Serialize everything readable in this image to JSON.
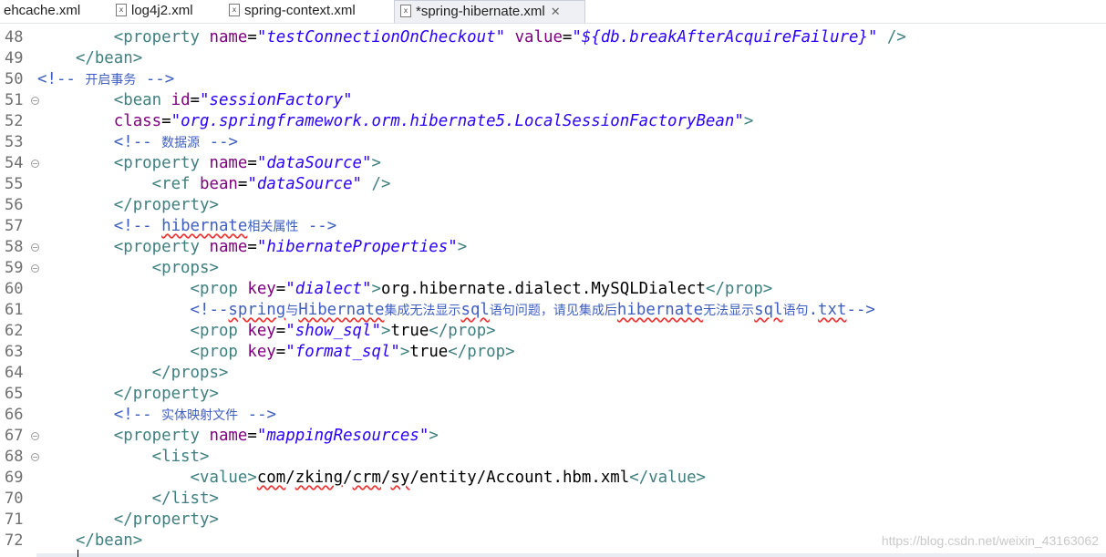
{
  "tabs": [
    {
      "label": "ehcache.xml",
      "active": false
    },
    {
      "label": "log4j2.xml",
      "active": false
    },
    {
      "label": "spring-context.xml",
      "active": false
    },
    {
      "label": "*spring-hibernate.xml",
      "active": true
    }
  ],
  "tab_close_glyph": "✕",
  "tab_icon_glyph": "x",
  "colors": {
    "tag": "#3f7f7f",
    "attribute": "#7f007f",
    "attribute_value": "#2a00ff",
    "comment": "#3f5fbf",
    "text": "#000000",
    "line_number": "#6f6f6f"
  },
  "editor": {
    "lines": [
      {
        "num": "48",
        "fold": false,
        "indent": "        ",
        "segments": [
          {
            "t": "<property ",
            "c": "tg"
          },
          {
            "t": "name",
            "c": "at"
          },
          {
            "t": "=",
            "c": "tx"
          },
          {
            "t": "\"testConnectionOnCheckout\"",
            "c": "av"
          },
          {
            "t": " ",
            "c": "tx"
          },
          {
            "t": "value",
            "c": "at"
          },
          {
            "t": "=",
            "c": "tx"
          },
          {
            "t": "\"${db.breakAfterAcquireFailure}\"",
            "c": "av"
          },
          {
            "t": " />",
            "c": "tg"
          }
        ]
      },
      {
        "num": "49",
        "fold": false,
        "indent": "    ",
        "segments": [
          {
            "t": "</bean>",
            "c": "tg"
          }
        ]
      },
      {
        "num": "50",
        "fold": false,
        "indent": "",
        "segments": [
          {
            "t": "<!-- ",
            "c": "cm"
          },
          {
            "t": "开启事务",
            "c": "cmz"
          },
          {
            "t": " -->",
            "c": "cm"
          }
        ]
      },
      {
        "num": "51",
        "fold": true,
        "indent": "        ",
        "segments": [
          {
            "t": "<bean ",
            "c": "tg"
          },
          {
            "t": "id",
            "c": "at"
          },
          {
            "t": "=",
            "c": "tx"
          },
          {
            "t": "\"sessionFactory\"",
            "c": "av"
          }
        ]
      },
      {
        "num": "52",
        "fold": false,
        "indent": "        ",
        "segments": [
          {
            "t": "class",
            "c": "at"
          },
          {
            "t": "=",
            "c": "tx"
          },
          {
            "t": "\"org.springframework.orm.hibernate5.LocalSessionFactoryBean\"",
            "c": "av"
          },
          {
            "t": ">",
            "c": "tg"
          }
        ]
      },
      {
        "num": "53",
        "fold": false,
        "indent": "        ",
        "segments": [
          {
            "t": "<!-- ",
            "c": "cm"
          },
          {
            "t": "数据源",
            "c": "cmz"
          },
          {
            "t": " -->",
            "c": "cm"
          }
        ]
      },
      {
        "num": "54",
        "fold": true,
        "indent": "        ",
        "segments": [
          {
            "t": "<property ",
            "c": "tg"
          },
          {
            "t": "name",
            "c": "at"
          },
          {
            "t": "=",
            "c": "tx"
          },
          {
            "t": "\"dataSource\"",
            "c": "av"
          },
          {
            "t": ">",
            "c": "tg"
          }
        ]
      },
      {
        "num": "55",
        "fold": false,
        "indent": "            ",
        "segments": [
          {
            "t": "<ref ",
            "c": "tg"
          },
          {
            "t": "bean",
            "c": "at"
          },
          {
            "t": "=",
            "c": "tx"
          },
          {
            "t": "\"dataSource\"",
            "c": "av"
          },
          {
            "t": " />",
            "c": "tg"
          }
        ]
      },
      {
        "num": "56",
        "fold": false,
        "indent": "        ",
        "segments": [
          {
            "t": "</property>",
            "c": "tg"
          }
        ]
      },
      {
        "num": "57",
        "fold": false,
        "indent": "        ",
        "segments": [
          {
            "t": "<!-- ",
            "c": "cm"
          },
          {
            "t": "hibernate",
            "c": "cm sq"
          },
          {
            "t": "相关属性",
            "c": "cmz"
          },
          {
            "t": " -->",
            "c": "cm"
          }
        ]
      },
      {
        "num": "58",
        "fold": true,
        "indent": "        ",
        "segments": [
          {
            "t": "<property ",
            "c": "tg"
          },
          {
            "t": "name",
            "c": "at"
          },
          {
            "t": "=",
            "c": "tx"
          },
          {
            "t": "\"hibernateProperties\"",
            "c": "av"
          },
          {
            "t": ">",
            "c": "tg"
          }
        ]
      },
      {
        "num": "59",
        "fold": true,
        "indent": "            ",
        "segments": [
          {
            "t": "<props>",
            "c": "tg"
          }
        ]
      },
      {
        "num": "60",
        "fold": false,
        "indent": "                ",
        "segments": [
          {
            "t": "<prop ",
            "c": "tg"
          },
          {
            "t": "key",
            "c": "at"
          },
          {
            "t": "=",
            "c": "tx"
          },
          {
            "t": "\"dialect\"",
            "c": "av"
          },
          {
            "t": ">",
            "c": "tg"
          },
          {
            "t": "org.hibernate.dialect.MySQLDialect",
            "c": "tx"
          },
          {
            "t": "</prop>",
            "c": "tg"
          }
        ]
      },
      {
        "num": "61",
        "fold": false,
        "indent": "                ",
        "segments": [
          {
            "t": "<!--",
            "c": "cm"
          },
          {
            "t": "spring",
            "c": "cm sq"
          },
          {
            "t": "与",
            "c": "cmz"
          },
          {
            "t": "Hibernate",
            "c": "cm sq"
          },
          {
            "t": "集成无法显示",
            "c": "cmz"
          },
          {
            "t": "sql",
            "c": "cm sq"
          },
          {
            "t": "语句问题，请见集成后",
            "c": "cmz"
          },
          {
            "t": "hibernate",
            "c": "cm sq"
          },
          {
            "t": "无法显示",
            "c": "cmz"
          },
          {
            "t": "sql",
            "c": "cm sq"
          },
          {
            "t": "语句",
            "c": "cmz"
          },
          {
            "t": ".",
            "c": "cm"
          },
          {
            "t": "txt",
            "c": "cm sq"
          },
          {
            "t": "-->",
            "c": "cm"
          }
        ]
      },
      {
        "num": "62",
        "fold": false,
        "indent": "                ",
        "segments": [
          {
            "t": "<prop ",
            "c": "tg"
          },
          {
            "t": "key",
            "c": "at"
          },
          {
            "t": "=",
            "c": "tx"
          },
          {
            "t": "\"show_sql\"",
            "c": "av"
          },
          {
            "t": ">",
            "c": "tg"
          },
          {
            "t": "true",
            "c": "tx"
          },
          {
            "t": "</prop>",
            "c": "tg"
          }
        ]
      },
      {
        "num": "63",
        "fold": false,
        "indent": "                ",
        "segments": [
          {
            "t": "<prop ",
            "c": "tg"
          },
          {
            "t": "key",
            "c": "at"
          },
          {
            "t": "=",
            "c": "tx"
          },
          {
            "t": "\"format_sql\"",
            "c": "av"
          },
          {
            "t": ">",
            "c": "tg"
          },
          {
            "t": "true",
            "c": "tx"
          },
          {
            "t": "</prop>",
            "c": "tg"
          }
        ]
      },
      {
        "num": "64",
        "fold": false,
        "indent": "            ",
        "segments": [
          {
            "t": "</props>",
            "c": "tg"
          }
        ]
      },
      {
        "num": "65",
        "fold": false,
        "indent": "        ",
        "segments": [
          {
            "t": "</property>",
            "c": "tg"
          }
        ]
      },
      {
        "num": "66",
        "fold": false,
        "indent": "        ",
        "segments": [
          {
            "t": "<!-- ",
            "c": "cm"
          },
          {
            "t": "实体映射文件",
            "c": "cmz"
          },
          {
            "t": " -->",
            "c": "cm"
          }
        ]
      },
      {
        "num": "67",
        "fold": true,
        "indent": "        ",
        "segments": [
          {
            "t": "<property ",
            "c": "tg"
          },
          {
            "t": "name",
            "c": "at"
          },
          {
            "t": "=",
            "c": "tx"
          },
          {
            "t": "\"mappingResources\"",
            "c": "av"
          },
          {
            "t": ">",
            "c": "tg"
          }
        ]
      },
      {
        "num": "68",
        "fold": true,
        "indent": "            ",
        "segments": [
          {
            "t": "<list>",
            "c": "tg"
          }
        ]
      },
      {
        "num": "69",
        "fold": false,
        "indent": "                ",
        "segments": [
          {
            "t": "<value>",
            "c": "tg"
          },
          {
            "t": "com",
            "c": "tx sq"
          },
          {
            "t": "/",
            "c": "tx"
          },
          {
            "t": "zking",
            "c": "tx sq"
          },
          {
            "t": "/",
            "c": "tx"
          },
          {
            "t": "crm",
            "c": "tx sq"
          },
          {
            "t": "/",
            "c": "tx"
          },
          {
            "t": "sy",
            "c": "tx sq"
          },
          {
            "t": "/entity/Account.hbm.xml",
            "c": "tx"
          },
          {
            "t": "</value>",
            "c": "tg"
          }
        ]
      },
      {
        "num": "70",
        "fold": false,
        "indent": "            ",
        "segments": [
          {
            "t": "</list>",
            "c": "tg"
          }
        ]
      },
      {
        "num": "71",
        "fold": false,
        "indent": "        ",
        "segments": [
          {
            "t": "</property>",
            "c": "tg"
          }
        ]
      },
      {
        "num": "72",
        "fold": false,
        "indent": "    ",
        "segments": [
          {
            "t": "</bean>",
            "c": "tg"
          }
        ]
      }
    ]
  },
  "watermark": "https://blog.csdn.net/weixin_43163062"
}
